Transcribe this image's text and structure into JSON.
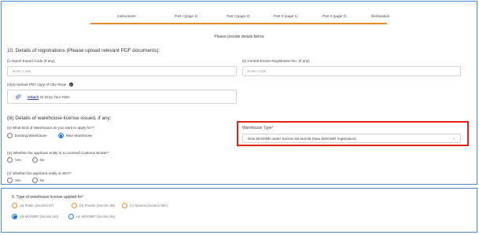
{
  "tabs": [
    "Instructions",
    "Part I (page 1)",
    "Part I (page 2)",
    "Part II (page 1)",
    "Part II (page 2)",
    "Declaration"
  ],
  "instruction": "Please provide details below",
  "section10": {
    "title": "10. Details of registrations (Please upload relevant PDF documents):",
    "iec_label": "(i) Import Export Code (if any)",
    "iec_placeholder": "Enter Code",
    "cer_label": "(ii) Central Excise Registration No. (if any)",
    "cer_placeholder": "Enter Code",
    "upload_label": "(ii)(a) Upload PDF copy of CEx Regn",
    "attach_label": "Attach",
    "drop_label": "Or Drop Your Files"
  },
  "section_iii": {
    "title": "(iii) Details of warehouse license issued, if any:",
    "kind_label": "(a) What kind of Warehouse do you want to apply for?",
    "required_mark": "*",
    "existing_label": "Existing Warehouse",
    "new_label": "New Warehouse",
    "warehouse_type_label": "Warehouse Type",
    "warehouse_type_value": "New MOOWR under Section 58 and 65 (New MOOWR registration)"
  },
  "section_iv": {
    "label": "(iv) Whether the applicant entity is a Licensed Customs Broker?",
    "yes": "Yes",
    "no": "No"
  },
  "section_v": {
    "label": "(v) Whether the applicant entity is AEO?",
    "yes": "Yes",
    "no": "No"
  },
  "panel2": {
    "title": "5. Type of warehouse license applied for",
    "required_mark": "*",
    "options": [
      "(a) Public (Section 57)",
      "(b) Private (Section 58)",
      "(c) Special (Section 58A)",
      "(d) MOOWR (Section 60)",
      "(e) MOOWR (Section 65)"
    ]
  },
  "colors": {
    "accent_orange": "#e98a2b",
    "highlight_red": "#e02418",
    "radio_blue": "#1a73e8",
    "panel_border": "#4a86c8"
  }
}
